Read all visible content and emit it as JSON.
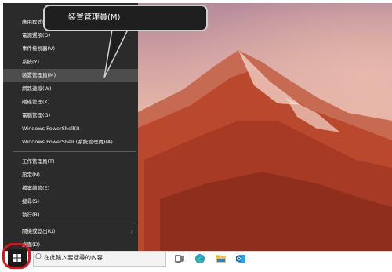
{
  "menu": {
    "items": [
      {
        "label": "應用程式(F)"
      },
      {
        "label": "電源選項(O)"
      },
      {
        "label": "事件檢視器(V)"
      },
      {
        "label": "系統(Y)"
      },
      {
        "label": "裝置管理員(M)"
      },
      {
        "label": "網路連線(W)"
      },
      {
        "label": "磁碟管理(K)"
      },
      {
        "label": "電腦管理(G)"
      },
      {
        "label": "Windows PowerShell(I)"
      },
      {
        "label": "Windows PowerShell (系統管理員)(A)"
      },
      {
        "label": "工作管理員(T)"
      },
      {
        "label": "設定(N)"
      },
      {
        "label": "檔案總管(E)"
      },
      {
        "label": "搜尋(S)"
      },
      {
        "label": "執行(R)"
      },
      {
        "label": "關機或登出(U)"
      },
      {
        "label": "桌面(D)"
      }
    ],
    "highlighted_index": 4,
    "submenu_chevron": "›"
  },
  "callout": {
    "text": "裝置管理員(M)"
  },
  "taskbar": {
    "search_placeholder": "在此輸入要搜尋的內容",
    "search_icon": "○",
    "icons": [
      "task-view-icon",
      "edge-icon",
      "file-explorer-icon",
      "outlook-icon"
    ]
  },
  "colors": {
    "menu_bg": "#2b2b2b",
    "menu_hover": "#4d4d4d",
    "highlight_ring": "#e0131a"
  }
}
